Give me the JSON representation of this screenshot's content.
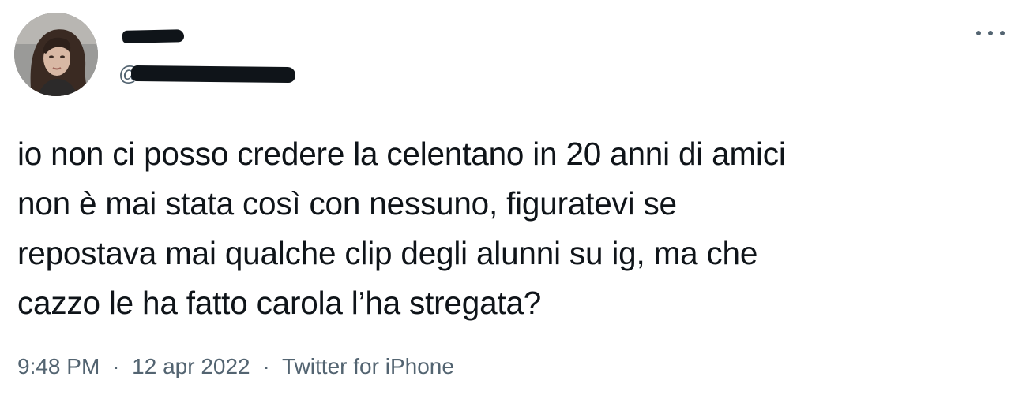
{
  "author": {
    "handle_prefix": "@",
    "avatar_icon": "profile-photo"
  },
  "tweet": {
    "lines": [
      "io non ci posso credere la celentano in 20 anni di amici",
      "non è mai stata così con nessuno, figuratevi se",
      "repostava mai qualche clip degli alunni su ig, ma che",
      "cazzo le ha fatto carola l’ha stregata?"
    ]
  },
  "meta": {
    "time": "9:48 PM",
    "separator": "·",
    "date": "12 apr 2022",
    "source": "Twitter for iPhone"
  },
  "menu": {
    "icon": "more-horizontal-icon"
  },
  "colors": {
    "text": "#0f1419",
    "secondary": "#536471",
    "background": "#ffffff"
  }
}
